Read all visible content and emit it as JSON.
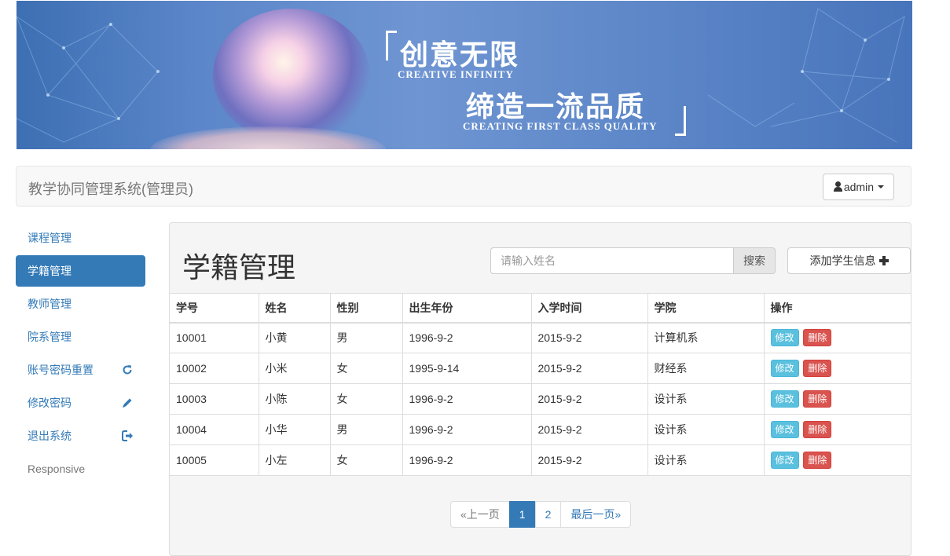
{
  "banner": {
    "title_cn": "创意无限",
    "title_en": "CREATIVE INFINITY",
    "subtitle_cn": "缔造一流品质",
    "subtitle_en": "CREATING FIRST CLASS QUALITY"
  },
  "navbar": {
    "brand": "教学协同管理系统(管理员)",
    "user_label": "admin"
  },
  "sidebar": {
    "items": [
      {
        "label": "课程管理",
        "icon": ""
      },
      {
        "label": "学籍管理",
        "icon": "",
        "active": true
      },
      {
        "label": "教师管理",
        "icon": ""
      },
      {
        "label": "院系管理",
        "icon": ""
      },
      {
        "label": "账号密码重置",
        "icon": "refresh-icon"
      },
      {
        "label": "修改密码",
        "icon": "pencil-icon"
      },
      {
        "label": "退出系统",
        "icon": "logout-icon"
      },
      {
        "label": "Responsive",
        "icon": ""
      }
    ]
  },
  "main": {
    "title": "学籍管理",
    "search": {
      "placeholder": "请输入姓名",
      "button": "搜索"
    },
    "add_button": "添加学生信息",
    "table": {
      "headers": [
        "学号",
        "姓名",
        "性别",
        "出生年份",
        "入学时间",
        "学院",
        "操作"
      ],
      "rows": [
        [
          "10001",
          "小黄",
          "男",
          "1996-9-2",
          "2015-9-2",
          "计算机系"
        ],
        [
          "10002",
          "小米",
          "女",
          "1995-9-14",
          "2015-9-2",
          "财经系"
        ],
        [
          "10003",
          "小陈",
          "女",
          "1996-9-2",
          "2015-9-2",
          "设计系"
        ],
        [
          "10004",
          "小华",
          "男",
          "1996-9-2",
          "2015-9-2",
          "设计系"
        ],
        [
          "10005",
          "小左",
          "女",
          "1996-9-2",
          "2015-9-2",
          "设计系"
        ]
      ],
      "edit_label": "修改",
      "delete_label": "删除"
    },
    "pagination": {
      "prev": "«上一页",
      "pages": [
        "1",
        "2"
      ],
      "current": "1",
      "last": "最后一页»"
    }
  },
  "colors": {
    "primary": "#337ab7",
    "info": "#5bc0de",
    "danger": "#d9534f"
  }
}
